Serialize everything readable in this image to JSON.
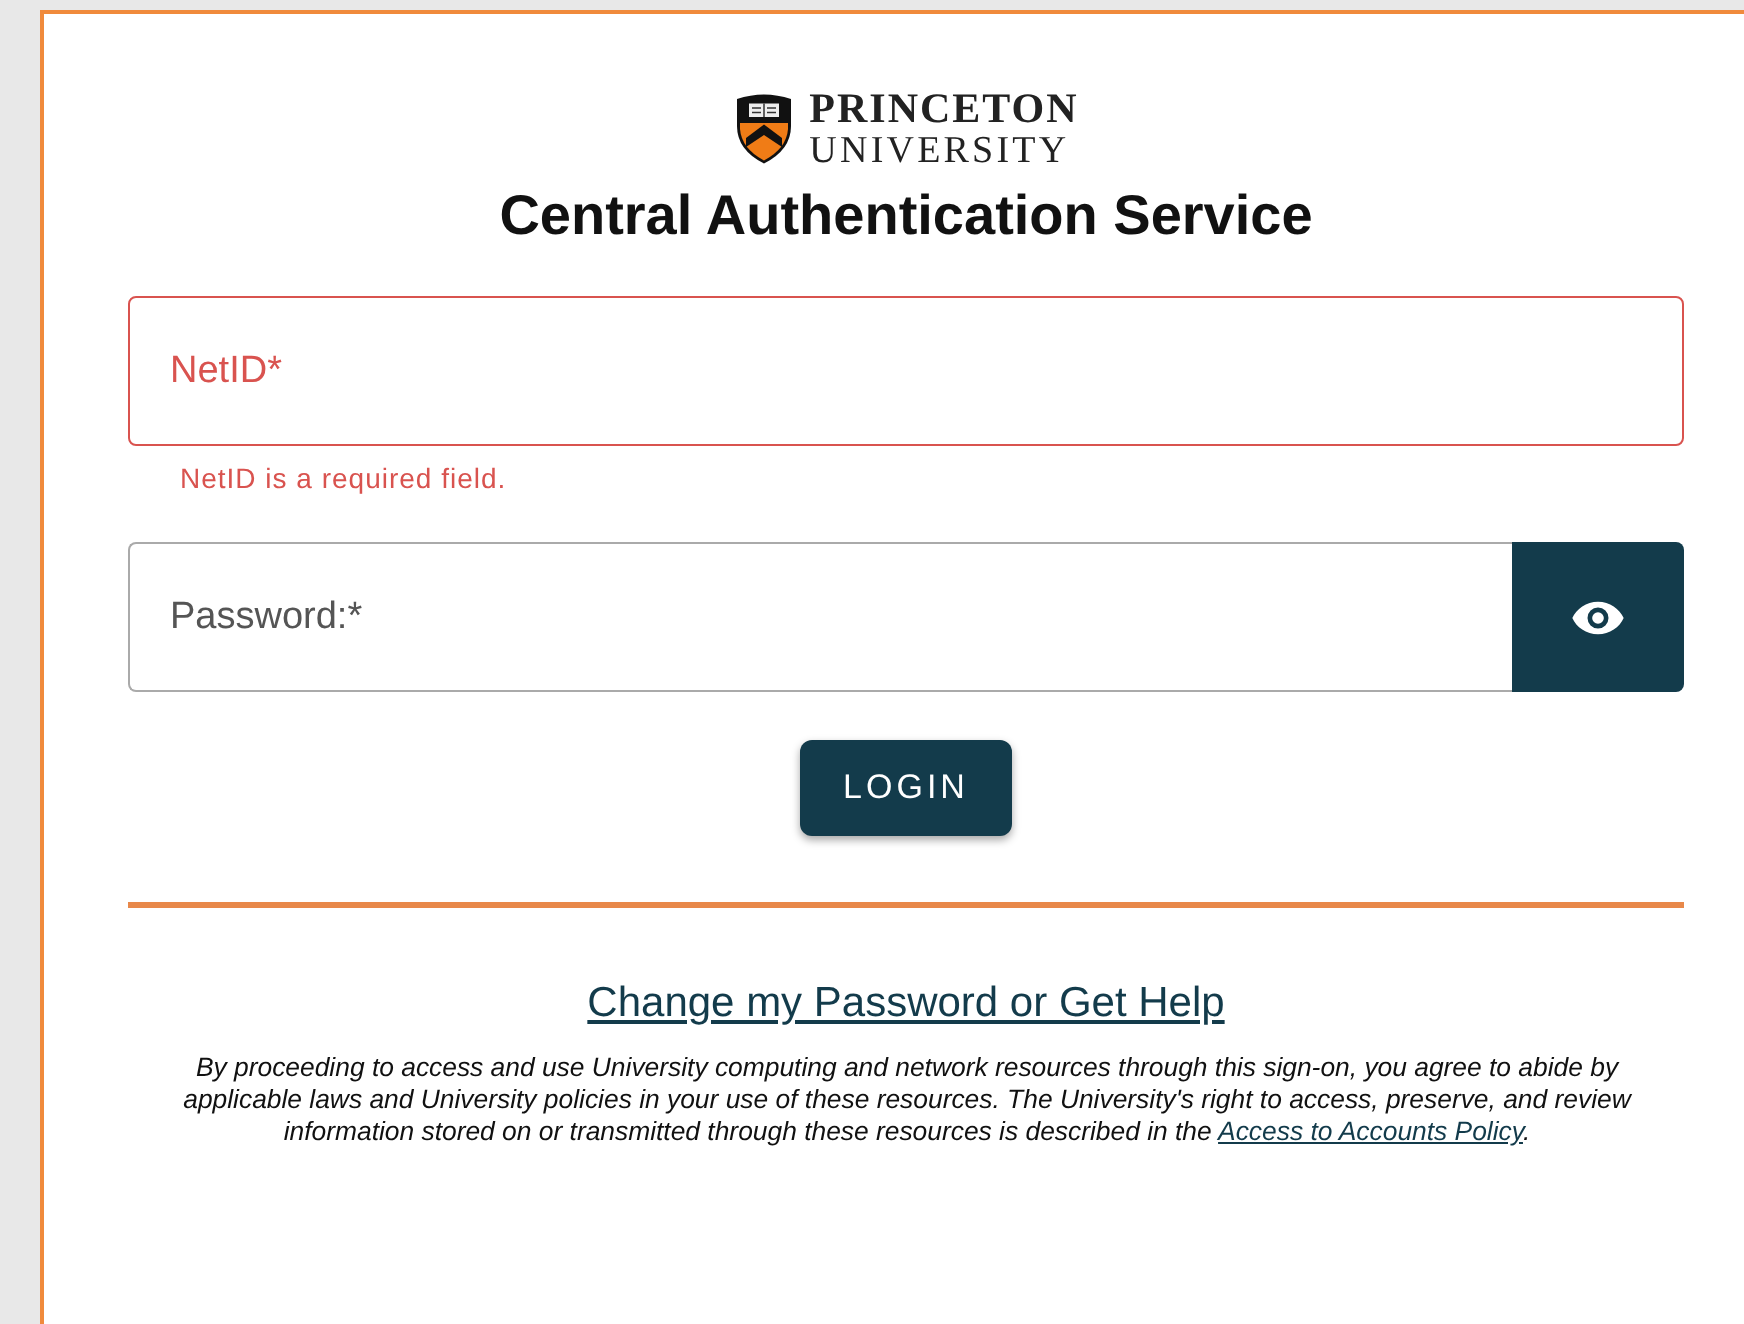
{
  "logo": {
    "line1": "PRINCETON",
    "line2": "UNIVERSITY"
  },
  "title": "Central Authentication Service",
  "fields": [
    {
      "placeholder": "NetID*",
      "error": true,
      "error_text": "NetID is a required field.",
      "reveal_button": false
    },
    {
      "placeholder": "Password:*",
      "error": false,
      "reveal_button": true
    }
  ],
  "login_button": "LOGIN",
  "help_link": "Change my Password or Get Help",
  "notice": {
    "text": "By proceeding to access and use University computing and network resources through this sign-on, you agree to abide by applicable laws and University policies in your use of these resources. The University's right to access, preserve, and review information stored on or transmitted through these resources is described in the ",
    "link": "Access to Accounts Policy",
    "end": "."
  }
}
